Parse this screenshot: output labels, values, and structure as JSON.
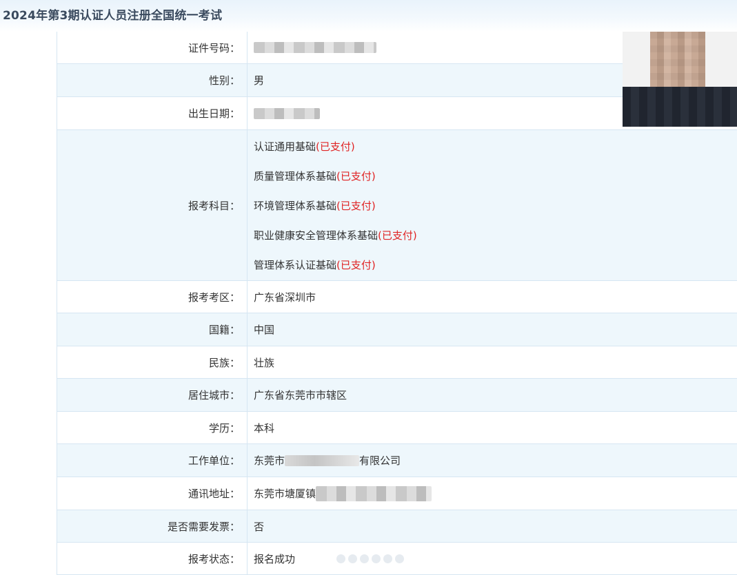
{
  "page": {
    "title": "2024年第3期认证人员注册全国统一考试"
  },
  "fields": {
    "id_number": {
      "label": "证件号码："
    },
    "gender": {
      "label": "性别：",
      "value": "男"
    },
    "birth_date": {
      "label": "出生日期："
    },
    "subjects": {
      "label": "报考科目：",
      "items": [
        {
          "name": "认证通用基础",
          "status": "(已支付)"
        },
        {
          "name": "质量管理体系基础",
          "status": "(已支付)"
        },
        {
          "name": "环境管理体系基础",
          "status": "(已支付)"
        },
        {
          "name": "职业健康安全管理体系基础",
          "status": "(已支付)"
        },
        {
          "name": "管理体系认证基础",
          "status": "(已支付)"
        }
      ]
    },
    "exam_area": {
      "label": "报考考区：",
      "value": "广东省深圳市"
    },
    "nationality": {
      "label": "国籍：",
      "value": "中国"
    },
    "ethnicity": {
      "label": "民族：",
      "value": "壮族"
    },
    "city": {
      "label": "居住城市：",
      "value": "广东省东莞市市辖区"
    },
    "education": {
      "label": "学历：",
      "value": "本科"
    },
    "employer": {
      "label": "工作单位：",
      "prefix": "东莞市",
      "suffix": "有限公司"
    },
    "address": {
      "label": "通讯地址：",
      "prefix": "东莞市塘厦镇"
    },
    "invoice": {
      "label": "是否需要发票：",
      "value": "否"
    },
    "status": {
      "label": "报考状态：",
      "value": "报名成功"
    }
  },
  "colors": {
    "paid": "#e02424",
    "row_alt": "#eef7fc",
    "border": "#d6e6f2"
  }
}
